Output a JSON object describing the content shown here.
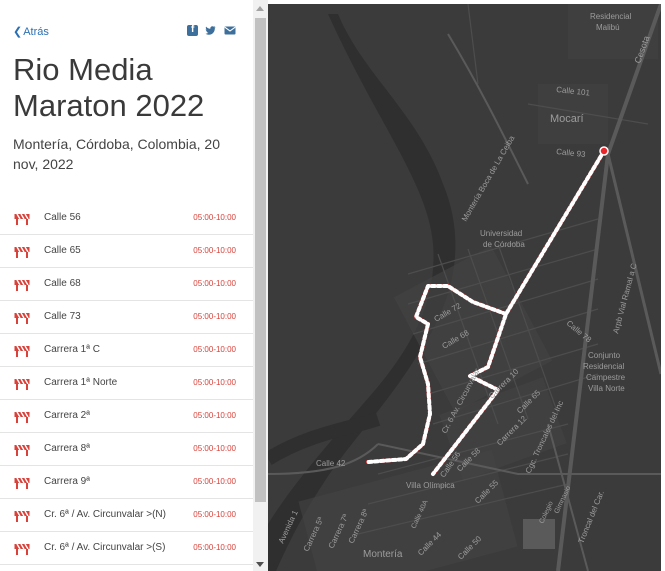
{
  "header": {
    "back_label": "Atrás",
    "back_icon": "chevron-left-icon",
    "share_icons": [
      "facebook-icon",
      "twitter-icon",
      "mail-icon"
    ]
  },
  "event": {
    "title": "Rio Media Maraton 2022",
    "subtitle": "Montería, Córdoba, Colombia, 20 nov, 2022"
  },
  "closures": [
    {
      "name": "Calle 56",
      "time": "05:00-10:00"
    },
    {
      "name": "Calle 65",
      "time": "05:00-10:00"
    },
    {
      "name": "Calle 68",
      "time": "05:00-10:00"
    },
    {
      "name": "Calle 73",
      "time": "05:00-10:00"
    },
    {
      "name": "Carrera 1ª C",
      "time": "05:00-10:00"
    },
    {
      "name": "Carrera 1ª Norte",
      "time": "05:00-10:00"
    },
    {
      "name": "Carrera 2ª",
      "time": "05:00-10:00"
    },
    {
      "name": "Carrera 8ª",
      "time": "05:00-10:00"
    },
    {
      "name": "Carrera 9ª",
      "time": "05:00-10:00"
    },
    {
      "name": "Cr. 6ª / Av. Circunvalar >(N)",
      "time": "05:00-10:00"
    },
    {
      "name": "Cr. 6ª / Av. Circunvalar >(S)",
      "time": "05:00-10:00"
    }
  ],
  "closure_icon": "road-barrier-icon",
  "colors": {
    "accent_red": "#d9423a",
    "link_blue": "#2a6fb3",
    "map_bg": "#3b3b3b",
    "route": "#e8262b"
  },
  "map": {
    "labels": {
      "residencial": "Residencial",
      "malibu": "Malibú",
      "calle101": "Calle 101",
      "mocari": "Mocarí",
      "calle93": "Calle 93",
      "bocaceiba": "Montería Boca de La Ceiba",
      "universidad": "Universidad",
      "decordoba": "de Córdoba",
      "calle78": "Calle 78",
      "calle72": "Calle 72",
      "calle68": "Calle 68",
      "circunvalar": "Cr. 6 Av. Circunvalar",
      "carrera10": "Carrera 10",
      "calle65": "Calle 65",
      "carrera12": "Carrera 12",
      "conjunto": "Conjunto",
      "residencialc": "Residencial",
      "campestre": "Campestre",
      "villanorte": "Villa Norte",
      "calle42": "Calle 42",
      "calle58": "Calle 58",
      "calle55": "Calle 55",
      "calle56": "Calle 56",
      "villaolimpica": "Villa Olímpica",
      "calle44": "Calle 44",
      "calle50": "Calle 50",
      "monteria": "Montería",
      "carrera5": "Carrera 5ª",
      "carrera7": "Carrera 7ª",
      "carrera8": "Carrera 8ª",
      "avenida1": "Avenida 1",
      "cesota": "Cesota",
      "arpb": "Arpb Vial Ramal a C",
      "troncal": "Troncal del Car.",
      "cgc": "Cgc. Troncales del Inc",
      "colegio": "Colegio",
      "gimnasio": "Gimnasio",
      "calle40a": "Calle 40A"
    }
  }
}
